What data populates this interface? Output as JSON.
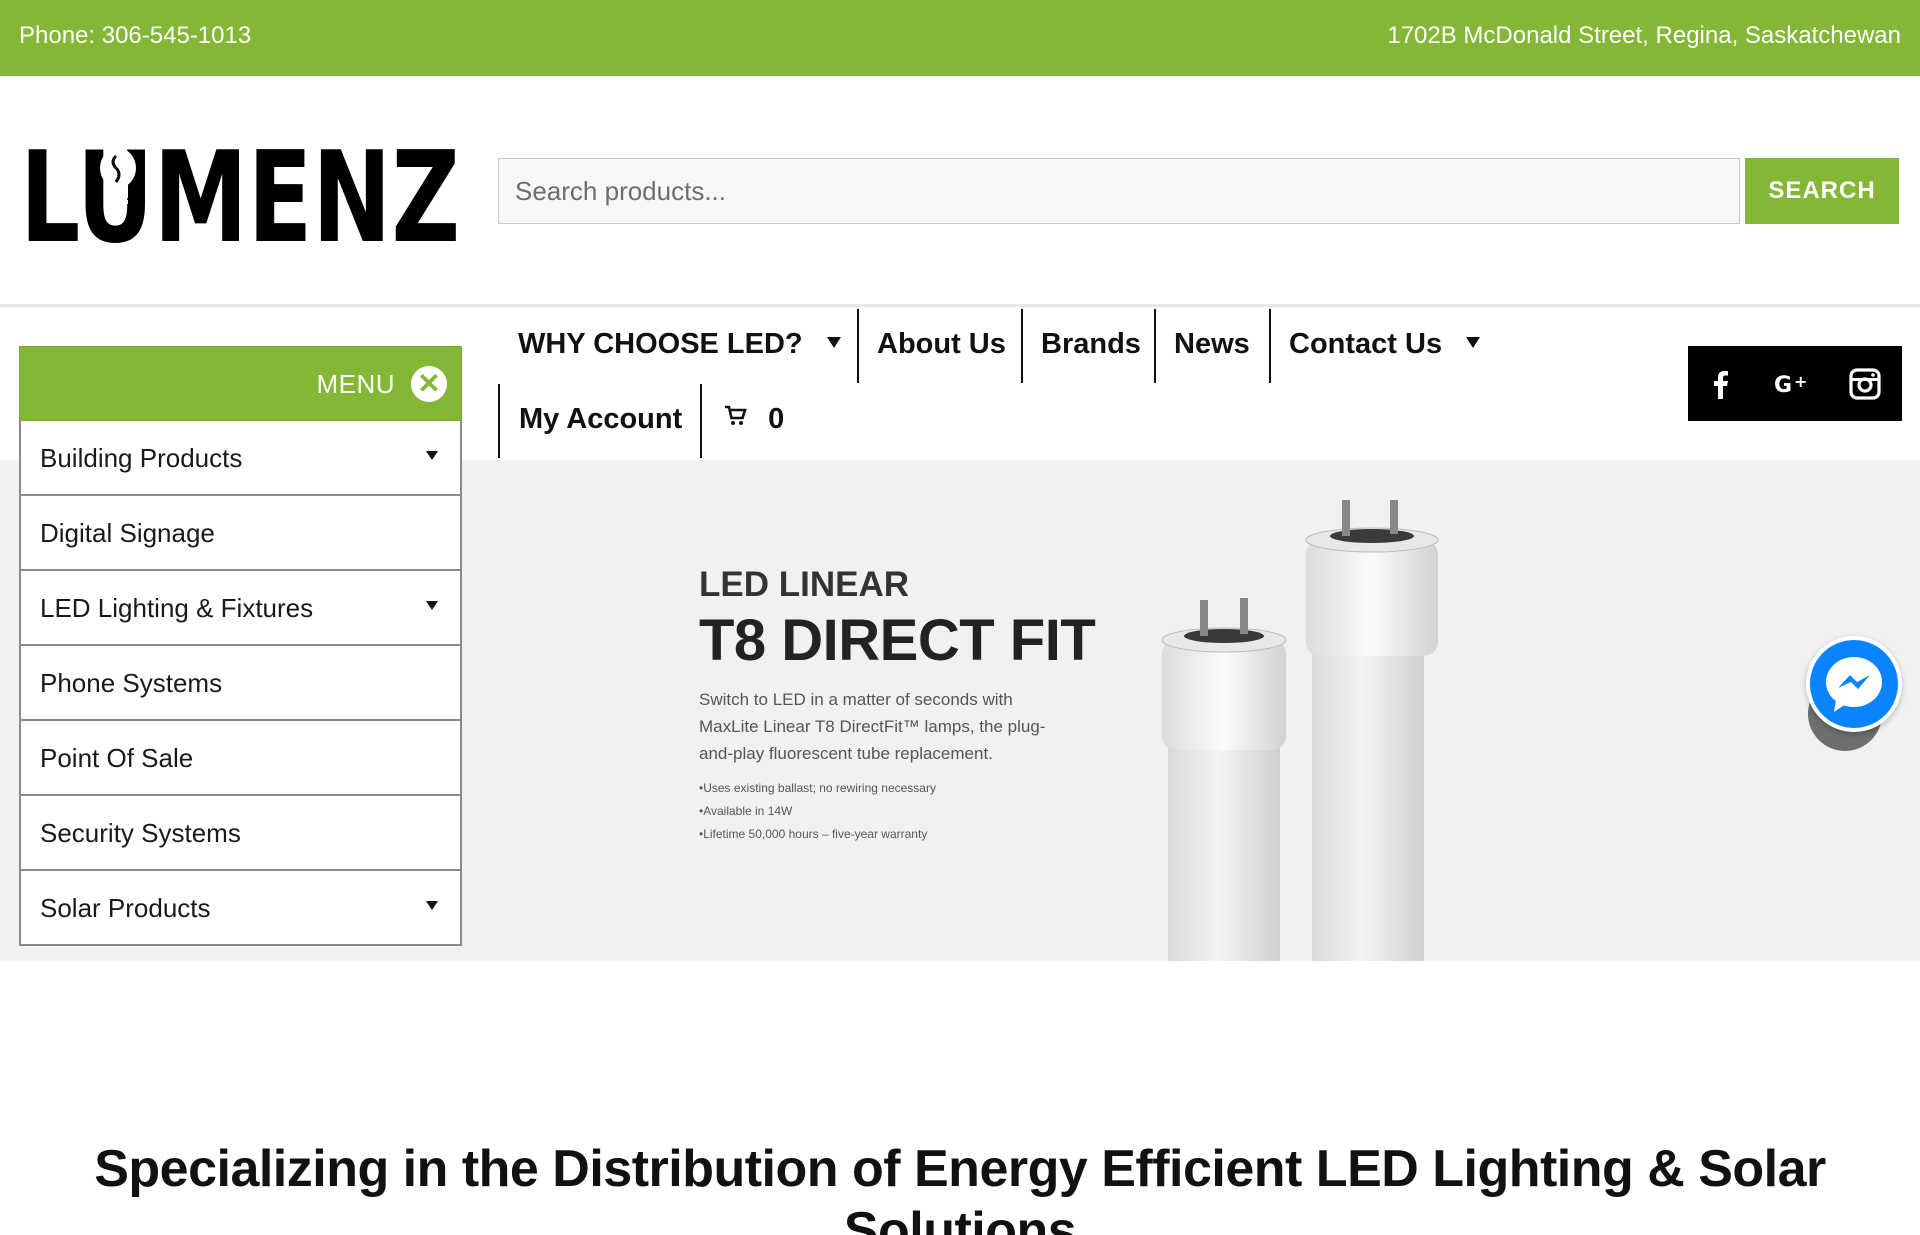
{
  "topbar": {
    "phone": "Phone: 306-545-1013",
    "address": "1702B McDonald Street, Regina, Saskatchewan"
  },
  "brand": {
    "logo_text": "LUMENZ"
  },
  "search": {
    "placeholder": "Search products...",
    "button_label": "SEARCH"
  },
  "nav": {
    "why_choose": "WHY CHOOSE LED?",
    "about": "About Us",
    "brands": "Brands",
    "news": "News",
    "contact": "Contact Us",
    "account": "My Account",
    "cart_count": "0"
  },
  "sidemenu": {
    "title": "MENU",
    "items": [
      {
        "label": "Building Products",
        "has_submenu": true
      },
      {
        "label": "Digital Signage",
        "has_submenu": false
      },
      {
        "label": "LED Lighting & Fixtures",
        "has_submenu": true
      },
      {
        "label": "Phone Systems",
        "has_submenu": false
      },
      {
        "label": "Point Of Sale",
        "has_submenu": false
      },
      {
        "label": "Security Systems",
        "has_submenu": false
      },
      {
        "label": "Solar Products",
        "has_submenu": true
      }
    ]
  },
  "social": {
    "icons": [
      "facebook-icon",
      "google-plus-icon",
      "instagram-icon"
    ]
  },
  "hero": {
    "kicker": "LED LINEAR",
    "title": "T8 DIRECT FIT",
    "description": "Switch to LED in a matter of seconds with MaxLite Linear T8 DirectFit™ lamps, the plug-and-play fluorescent tube replacement.",
    "bullets": [
      "Uses existing ballast; no rewiring necessary",
      "Available in 14W",
      "Lifetime 50,000 hours – five-year warranty"
    ]
  },
  "tagline": "Specializing in the Distribution of Energy Efficient LED Lighting & Solar Solutions",
  "colors": {
    "brand_green": "#84b736",
    "messenger_blue": "#0a84ff"
  }
}
